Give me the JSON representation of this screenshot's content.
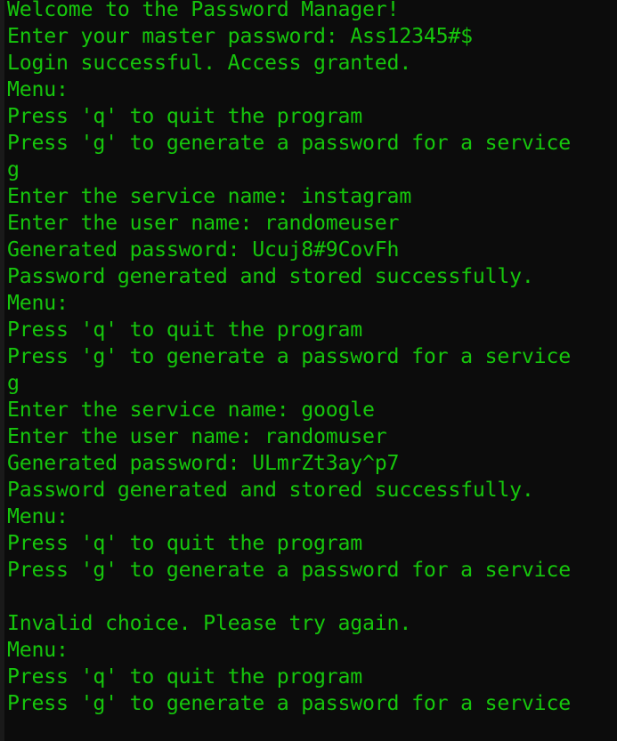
{
  "terminal": {
    "text_color": "#16c60c",
    "background": "#0c0c0c",
    "lines": [
      "Welcome to the Password Manager!",
      "Enter your master password: Ass12345#$",
      "Login successful. Access granted.",
      "Menu:",
      "Press 'q' to quit the program",
      "Press 'g' to generate a password for a service",
      "g",
      "Enter the service name: instagram",
      "Enter the user name: randomeuser",
      "Generated password: Ucuj8#9CovFh",
      "Password generated and stored successfully.",
      "Menu:",
      "Press 'q' to quit the program",
      "Press 'g' to generate a password for a service",
      "g",
      "Enter the service name: google",
      "Enter the user name: randomuser",
      "Generated password: ULmrZt3ay^p7",
      "Password generated and stored successfully.",
      "Menu:",
      "Press 'q' to quit the program",
      "Press 'g' to generate a password for a service",
      "",
      "Invalid choice. Please try again.",
      "Menu:",
      "Press 'q' to quit the program",
      "Press 'g' to generate a password for a service"
    ]
  }
}
